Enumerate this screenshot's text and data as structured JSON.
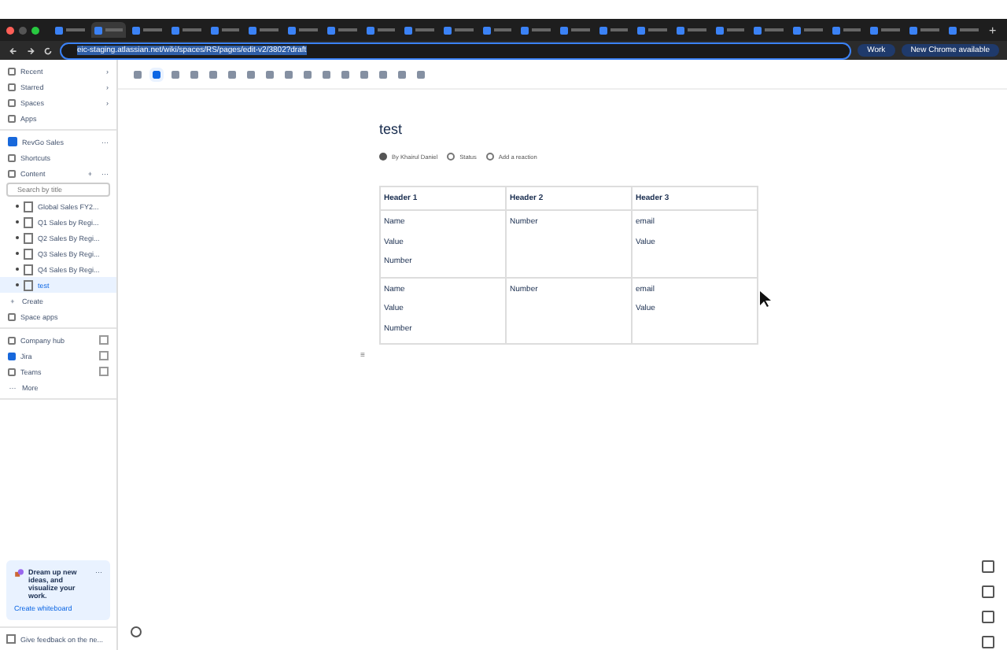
{
  "browser": {
    "tabs": [
      {
        "selected": false
      },
      {
        "selected": true
      },
      {
        "selected": false
      },
      {
        "selected": false
      },
      {
        "selected": false
      },
      {
        "selected": false
      },
      {
        "selected": false
      },
      {
        "selected": false
      },
      {
        "selected": false
      },
      {
        "selected": false
      },
      {
        "selected": false
      },
      {
        "selected": false
      },
      {
        "selected": false
      },
      {
        "selected": false
      },
      {
        "selected": false
      },
      {
        "selected": false
      },
      {
        "selected": false
      },
      {
        "selected": false
      },
      {
        "selected": false
      },
      {
        "selected": false
      },
      {
        "selected": false
      },
      {
        "selected": false
      },
      {
        "selected": false
      },
      {
        "selected": false
      }
    ],
    "new_tab": "+",
    "url": "eic-staging.atlassian.net/wiki/spaces/RS/pages/edit-v2/3802?draft",
    "profile": "Work",
    "update_button": "New Chrome available"
  },
  "sidebar": {
    "nav": [
      {
        "label": "Recent",
        "chevron": "›"
      },
      {
        "label": "Starred",
        "chevron": "›"
      },
      {
        "label": "Spaces",
        "chevron": "›"
      },
      {
        "label": "Apps"
      }
    ],
    "space": {
      "name": "RevGo Sales",
      "more": "···"
    },
    "shortcuts": "Shortcuts",
    "content": {
      "label": "Content",
      "add": "+",
      "more": "···"
    },
    "search": {
      "placeholder": "Search by title"
    },
    "pages": [
      {
        "title": "Global Sales FY2...",
        "selected": false
      },
      {
        "title": "Q1 Sales by Regi...",
        "selected": false
      },
      {
        "title": "Q2 Sales By Regi...",
        "selected": false
      },
      {
        "title": "Q3 Sales By Regi...",
        "selected": false
      },
      {
        "title": "Q4 Sales By Regi...",
        "selected": false
      },
      {
        "title": "test",
        "selected": true
      }
    ],
    "create": {
      "icon": "+",
      "label": "Create"
    },
    "space_apps": "Space apps",
    "links": [
      {
        "label": "Company hub"
      },
      {
        "label": "Jira"
      },
      {
        "label": "Teams"
      }
    ],
    "more": {
      "icon": "···",
      "label": "More"
    },
    "promo": {
      "text": "Dream up new ideas, and visualize your work.",
      "link": "Create whiteboard",
      "more": "···"
    },
    "feedback": "Give feedback on the ne..."
  },
  "editor": {
    "title": "test",
    "byline": "By Khairul Daniel",
    "status": "Status",
    "reaction": "Add a reaction",
    "table": {
      "headers": [
        "Header 1",
        "Header 2",
        "Header 3"
      ],
      "rows": [
        [
          [
            "Name",
            "Value",
            "Number"
          ],
          [
            "Number"
          ],
          [
            "email",
            "Value"
          ]
        ],
        [
          [
            "Name",
            "Value",
            "Number"
          ],
          [
            "Number"
          ],
          [
            "email",
            "Value"
          ]
        ]
      ]
    },
    "footer_mark": "≡"
  }
}
